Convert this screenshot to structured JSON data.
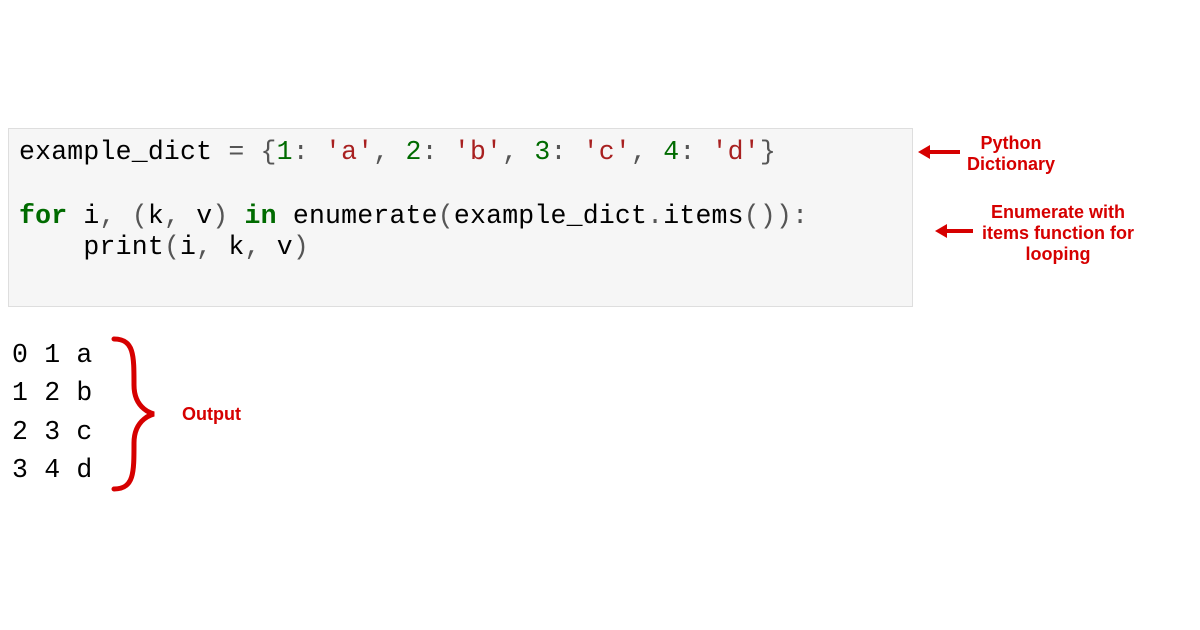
{
  "code": {
    "line1": {
      "var": "example_dict",
      "eq": " = ",
      "open": "{",
      "p1k": "1",
      "p1c": ": ",
      "p1v": "'a'",
      "s1": ", ",
      "p2k": "2",
      "p2c": ": ",
      "p2v": "'b'",
      "s2": ", ",
      "p3k": "3",
      "p3c": ": ",
      "p3v": "'c'",
      "s3": ", ",
      "p4k": "4",
      "p4c": ": ",
      "p4v": "'d'",
      "close": "}"
    },
    "blank": "",
    "line2": {
      "for": "for",
      "sp1": " ",
      "i": "i",
      "comma1": ", ",
      "open": "(",
      "k": "k",
      "comma2": ", ",
      "v": "v",
      "close": ") ",
      "in": "in",
      "sp2": " ",
      "enum": "enumerate",
      "paro": "(",
      "ex": "example_dict",
      "dot": ".",
      "items": "items",
      "call": "()",
      "parc": ")",
      "colon": ":"
    },
    "line3": {
      "indent": "    ",
      "print": "print",
      "open": "(",
      "i": "i",
      "c1": ", ",
      "k": "k",
      "c2": ", ",
      "v": "v",
      "close": ")"
    }
  },
  "output": {
    "l1": "0 1 a",
    "l2": "1 2 b",
    "l3": "2 3 c",
    "l4": "3 4 d"
  },
  "annotations": {
    "dict": "Python\nDictionary",
    "enum": "Enumerate with\nitems function for\nlooping",
    "out": "Output"
  },
  "colors": {
    "annotation": "#d60000"
  }
}
